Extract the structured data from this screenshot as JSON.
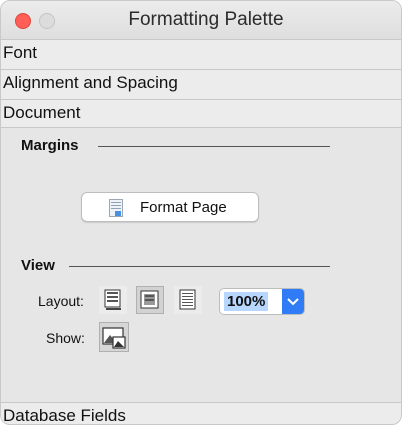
{
  "window": {
    "title": "Formatting Palette"
  },
  "sections": {
    "font": "Font",
    "alignment": "Alignment and Spacing",
    "document": "Document",
    "database_fields": "Database Fields"
  },
  "margins": {
    "heading": "Margins",
    "format_page_button": "Format Page"
  },
  "view": {
    "heading": "View",
    "layout_label": "Layout:",
    "show_label": "Show:",
    "zoom_value": "100%"
  }
}
